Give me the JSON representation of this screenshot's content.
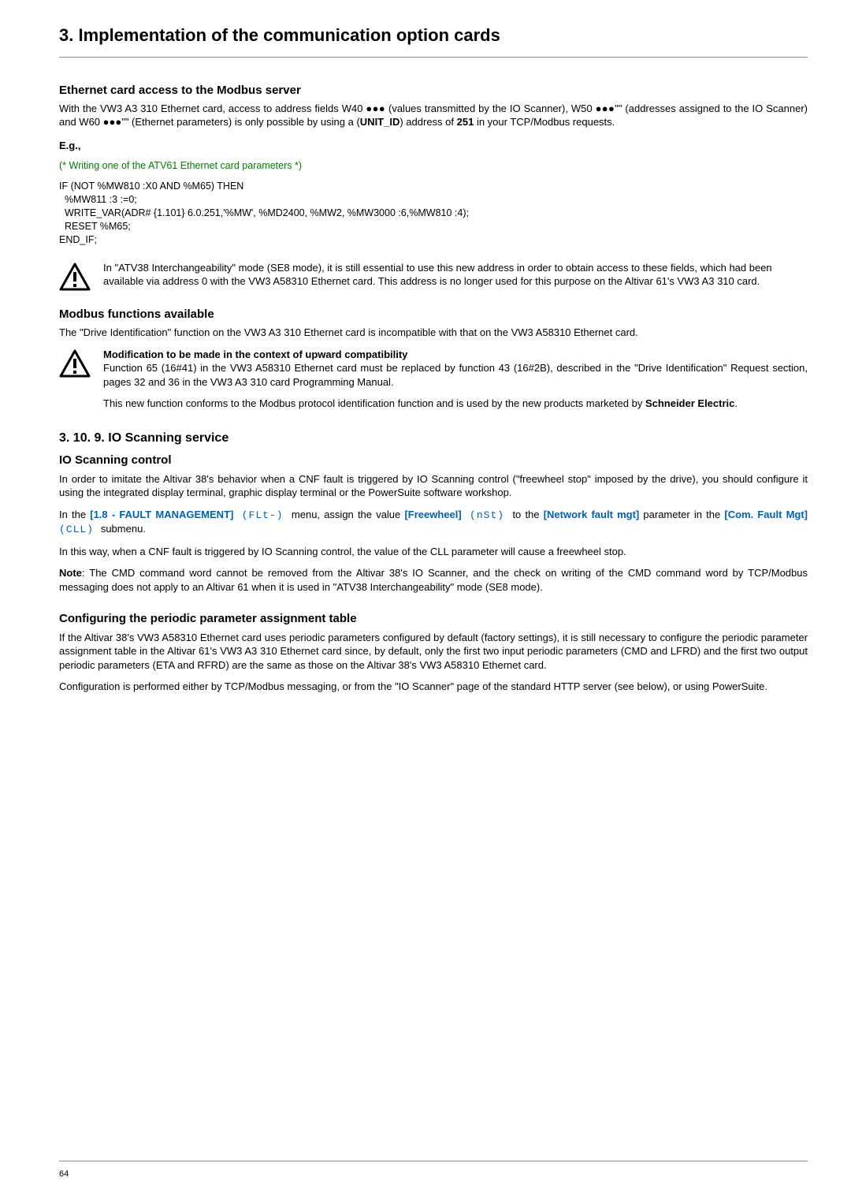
{
  "page_title": "3. Implementation of the communication option cards",
  "section_ethernet": {
    "heading": "Ethernet card access to the Modbus server",
    "p1_a": "With the VW3 A3 310 Ethernet card, access to address fields W40 ●●● (values transmitted by the IO Scanner), W50 ●●●\"\" (addresses assigned to the IO Scanner) and W60 ●●●\"\" (Ethernet parameters) is only possible by using a (",
    "p1_b": "UNIT_ID",
    "p1_c": ") address of ",
    "p1_d": "251",
    "p1_e": " in your TCP/Modbus requests.",
    "eg": "E.g.,",
    "code_comment": "(* Writing one of the ATV61 Ethernet card parameters *)",
    "code_block": "IF (NOT %MW810 :X0 AND %M65) THEN\n  %MW811 :3 :=0;\n  WRITE_VAR(ADR# {1.101} 6.0.251,'%MW', %MD2400, %MW2, %MW3000 :6,%MW810 :4);\n  RESET %M65;\nEND_IF;",
    "warn1": "In \"ATV38 Interchangeability\" mode (SE8 mode), it is still essential to use this new address in order to obtain access to these fields, which had been available via address 0 with the VW3 A58310 Ethernet card. This address is no longer used for this purpose on the Altivar 61's VW3 A3 310 card."
  },
  "section_modbus": {
    "heading": "Modbus functions available",
    "p1": "The \"Drive Identification\" function on the VW3 A3 310 Ethernet card is incompatible with that on the VW3 A58310 Ethernet card.",
    "warn2_h": "Modification to be made in the context of upward compatibility",
    "warn2_p1": "Function 65 (16#41) in the VW3 A58310 Ethernet card must be replaced by function 43 (16#2B), described in the \"Drive Identification\" Request section, pages 32 and 36 in the VW3 A3 310 card Programming Manual.",
    "warn2_p2a": "This new function conforms to the Modbus protocol identification function and is used by the new products marketed by ",
    "warn2_p2b": "Schneider Electric",
    "warn2_p2c": "."
  },
  "section_io": {
    "heading": "3. 10. 9. IO Scanning service",
    "sub1": "IO Scanning control",
    "p1": "In order to imitate the Altivar 38's behavior when a CNF fault is triggered by IO Scanning control (\"freewheel stop\" imposed by the drive), you should configure it using the integrated display terminal, graphic display terminal or the PowerSuite software workshop.",
    "p2": {
      "a": "In the ",
      "menu1": "[1.8 - FAULT MANAGEMENT]",
      "seg1_open": " (",
      "seg1": "FLt-",
      "seg1_close": ") ",
      "b": "menu, assign the value ",
      "menu2": "[Freewheel]",
      "seg2_open": " (",
      "seg2": "nSt",
      "seg2_close": ") ",
      "c": "to the ",
      "menu3": "[Network fault mgt]",
      "d": " parameter in the ",
      "menu4": "[Com. Fault Mgt]",
      "seg3_open": " (",
      "seg3": "CLL",
      "seg3_close": ") ",
      "e": "submenu."
    },
    "p3": "In this way, when a CNF fault is triggered by IO Scanning control, the value of the CLL parameter will cause a freewheel stop.",
    "p4a": "Note",
    "p4b": ": The CMD command word cannot be removed from the Altivar 38's IO Scanner, and the check on writing of the CMD command word by TCP/Modbus messaging does not apply to an Altivar 61 when it is used in \"ATV38 Interchangeability\" mode (SE8 mode).",
    "sub2": "Configuring the periodic parameter assignment table",
    "p5": "If the Altivar 38's VW3 A58310 Ethernet card uses periodic parameters configured by default (factory settings), it is still necessary to configure the periodic parameter assignment table in the Altivar 61's VW3 A3 310 Ethernet card since, by default, only the first two input periodic parameters (CMD and LFRD) and the first two output periodic parameters (ETA and RFRD) are the same as those on the Altivar 38's VW3 A58310 Ethernet card.",
    "p6": "Configuration is performed either by TCP/Modbus messaging, or from the \"IO Scanner\" page of the standard HTTP server (see below), or using PowerSuite."
  },
  "page_number": "64"
}
